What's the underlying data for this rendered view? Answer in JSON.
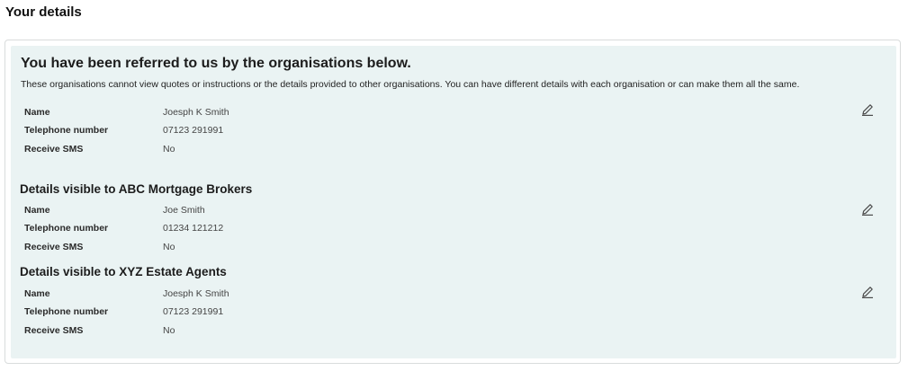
{
  "page": {
    "title": "Your details"
  },
  "intro": {
    "heading": "You have been referred to us by the organisations below.",
    "text": "These organisations cannot view quotes or instructions or the details provided to other organisations. You can have different details with each organisation or can make them all the same."
  },
  "main_details": [
    {
      "label": "Name",
      "value": "Joesph K Smith"
    },
    {
      "label": "Telephone number",
      "value": "07123 291991"
    },
    {
      "label": "Receive SMS",
      "value": "No"
    }
  ],
  "sections": [
    {
      "heading": "Details visible to ABC Mortgage Brokers",
      "fields": [
        {
          "label": "Name",
          "value": "Joe Smith"
        },
        {
          "label": "Telephone number",
          "value": "01234 121212"
        },
        {
          "label": "Receive SMS",
          "value": "No"
        }
      ]
    },
    {
      "heading": "Details visible to XYZ Estate Agents",
      "fields": [
        {
          "label": "Name",
          "value": "Joesph K Smith"
        },
        {
          "label": "Telephone number",
          "value": "07123 291991"
        },
        {
          "label": "Receive SMS",
          "value": "No"
        }
      ]
    }
  ],
  "icons": {
    "edit": "pencil-icon"
  },
  "colors": {
    "panel_background": "#eaf3f3",
    "card_border": "#d9dcdc"
  }
}
